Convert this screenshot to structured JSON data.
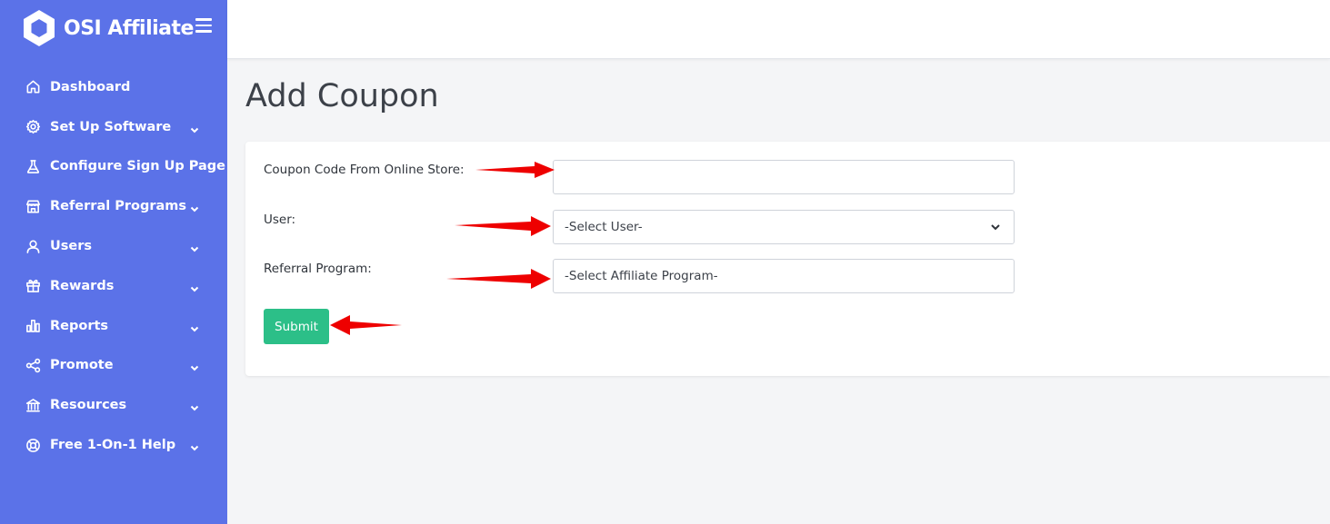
{
  "app": {
    "brand_name": "OSI Affiliate"
  },
  "sidebar": {
    "items": [
      {
        "label": "Dashboard",
        "icon": "home-icon",
        "has_submenu": false
      },
      {
        "label": "Set Up Software",
        "icon": "gear-icon",
        "has_submenu": true
      },
      {
        "label": "Configure Sign Up Page",
        "icon": "flask-icon",
        "has_submenu": false
      },
      {
        "label": "Referral Programs",
        "icon": "store-icon",
        "has_submenu": true
      },
      {
        "label": "Users",
        "icon": "user-icon",
        "has_submenu": true
      },
      {
        "label": "Rewards",
        "icon": "gift-icon",
        "has_submenu": true
      },
      {
        "label": "Reports",
        "icon": "bar-chart-icon",
        "has_submenu": true
      },
      {
        "label": "Promote",
        "icon": "share-icon",
        "has_submenu": true
      },
      {
        "label": "Resources",
        "icon": "bank-icon",
        "has_submenu": true
      },
      {
        "label": "Free 1-On-1 Help",
        "icon": "lifebuoy-icon",
        "has_submenu": true
      }
    ]
  },
  "page": {
    "title": "Add Coupon"
  },
  "form": {
    "coupon_label": "Coupon Code From Online Store:",
    "coupon_value": "",
    "user_label": "User:",
    "user_select_value": "-Select User-",
    "program_label": "Referral Program:",
    "program_select_value": "-Select Affiliate Program-",
    "submit_label": "Submit"
  },
  "colors": {
    "sidebar_bg": "#5b72e8",
    "submit_bg": "#2cbf88",
    "annotation_arrow": "#ee0000"
  }
}
